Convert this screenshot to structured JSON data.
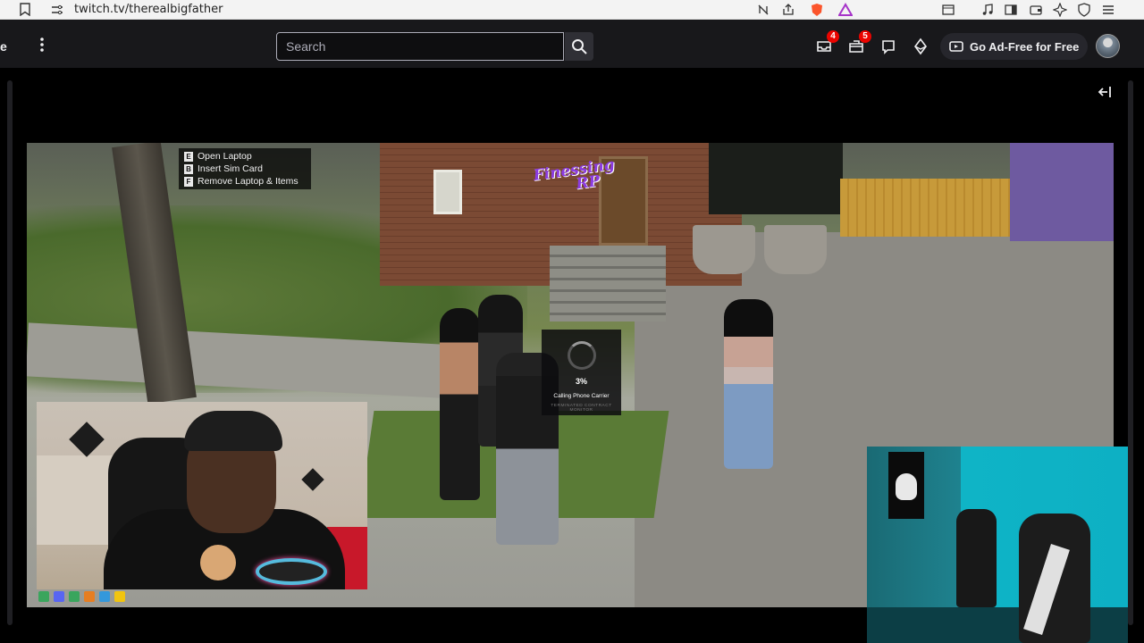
{
  "browser": {
    "url": "twitch.tv/therealbigfather"
  },
  "nav": {
    "left_fragment": "e",
    "search_placeholder": "Search",
    "inbox_badge": "4",
    "whispers_badge": "5",
    "ad_free_label": "Go Ad-Free for Free"
  },
  "game": {
    "logo_line1": "Finessing",
    "logo_line2": "RP",
    "prompt_items": [
      {
        "key": "E",
        "label": "Open Laptop"
      },
      {
        "key": "B",
        "label": "Insert Sim Card"
      },
      {
        "key": "F",
        "label": "Remove Laptop & Items"
      }
    ],
    "phone": {
      "percent": "3%",
      "status": "Calling Phone Carrier",
      "sub": "TERMINATED CONTRACT MONITOR"
    }
  },
  "colors": {
    "twitch_bg": "#18181b",
    "badge_red": "#eb0400",
    "logo_purple": "#8c3ce0"
  }
}
